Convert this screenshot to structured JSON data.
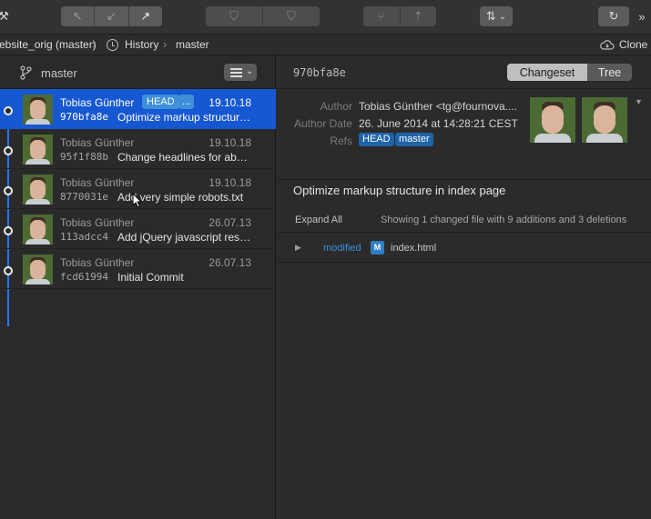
{
  "toolbar": {
    "left_tool_glyph": "⚒",
    "group1": [
      {
        "icon": "fetch-icon",
        "glyph": "↖"
      },
      {
        "icon": "pull-icon",
        "glyph": "↙"
      },
      {
        "icon": "push-icon",
        "glyph": "↗"
      }
    ],
    "group2": [
      {
        "icon": "stash-icon",
        "glyph": "⛉"
      },
      {
        "icon": "pop-stash-icon",
        "glyph": "⛉"
      }
    ],
    "group3": [
      {
        "icon": "branch-icon",
        "glyph": "⑂"
      },
      {
        "icon": "merge-icon",
        "glyph": "⇡"
      }
    ],
    "filter_glyph": "⇅",
    "filter_chevron": "⌄",
    "refresh_glyph": "↻",
    "overflow_glyph": "»"
  },
  "pathbar": {
    "repo": "ebsite_orig (master)",
    "separator": "›",
    "history_label": "History",
    "branch_label": "master",
    "clone_label": "Clone"
  },
  "history": {
    "branch": "master",
    "commits": [
      {
        "author": "Tobias Günther",
        "date": "19.10.18",
        "hash": "970bfa8e",
        "subject": "Optimize markup structure in index page",
        "tags": [
          "HEAD",
          "..."
        ]
      },
      {
        "author": "Tobias Günther",
        "date": "19.10.18",
        "hash": "95f1f88b",
        "subject": "Change headlines for about page",
        "tags": []
      },
      {
        "author": "Tobias Günther",
        "date": "19.10.18",
        "hash": "8770031e",
        "subject": "Add very simple robots.txt",
        "tags": []
      },
      {
        "author": "Tobias Günther",
        "date": "26.07.13",
        "hash": "113adcc4",
        "subject": "Add jQuery javascript resources",
        "tags": []
      },
      {
        "author": "Tobias Günther",
        "date": "26.07.13",
        "hash": "fcd61994",
        "subject": "Initial Commit",
        "tags": []
      }
    ]
  },
  "detail": {
    "hash": "970bfa8e",
    "tabs": [
      "Changeset",
      "Tree"
    ],
    "active_tab": "Changeset",
    "author_label": "Author",
    "author_value": "Tobias Günther <tg@fournova....",
    "date_label": "Author Date",
    "date_value": "26. June 2014 at 14:28:21 CEST",
    "refs_label": "Refs",
    "refs": [
      "HEAD",
      "master"
    ],
    "message": "Optimize markup structure in index page",
    "expand_all": "Expand All",
    "summary": "Showing 1 changed file with 9 additions and 3 deletions",
    "files": [
      {
        "status": "modified",
        "badge": "M",
        "name": "index.html"
      }
    ]
  },
  "colors": {
    "selection": "#1657d2",
    "graph_line": "#1f78ff",
    "ref_badge": "#1f63a8",
    "modified": "#3d8fe0"
  }
}
